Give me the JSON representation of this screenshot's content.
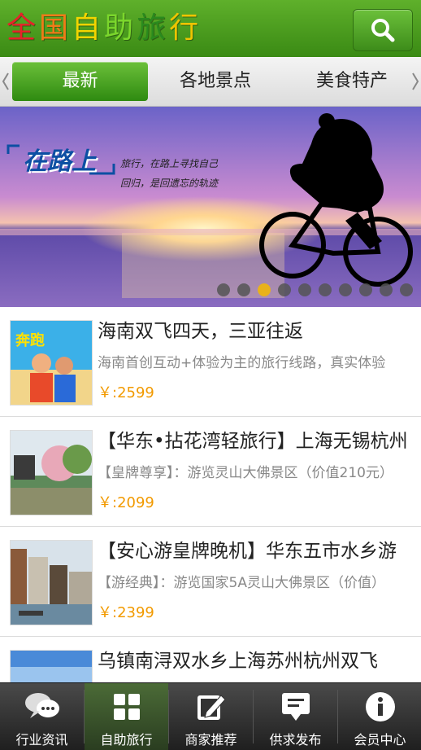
{
  "header": {
    "title_chars": [
      {
        "char": "全",
        "color": "#e8222a"
      },
      {
        "char": "国",
        "color": "#f07a18"
      },
      {
        "char": "自",
        "color": "#f2d400"
      },
      {
        "char": "助",
        "color": "#7bd62c"
      },
      {
        "char": "旅",
        "color": "#2a8a1e"
      },
      {
        "char": "行",
        "color": "#f0c400"
      }
    ],
    "search_icon": "search-icon"
  },
  "tabs": [
    {
      "label": "最新",
      "active": true
    },
    {
      "label": "各地景点",
      "active": false
    },
    {
      "label": "美食特产",
      "active": false
    }
  ],
  "banner": {
    "badge": "在路上",
    "line1": "旅行，在路上寻找自己",
    "line2": "回归，是回遗忘的轨迹",
    "dot_count": 10,
    "active_dot": 2,
    "colors": {
      "sky_top": "#6b63c8",
      "sky_mid": "#c98bd0",
      "sun": "#ffe6a0",
      "sea": "#5d4aa8"
    }
  },
  "list": [
    {
      "title": "海南双飞四天，三亚往返",
      "desc": "海南首创互动+体验为主的旅行线路，真实体验",
      "price": "￥:2599",
      "thumb": "beach-poster"
    },
    {
      "title": "【华东•拈花湾轻旅行】上海无锡杭州",
      "desc": "【皇牌尊享】：游览灵山大佛景区（价值210元）",
      "price": "￥:2099",
      "thumb": "garden-lake"
    },
    {
      "title": "【安心游皇牌晚机】华东五市水乡游",
      "desc": "【游经典】：游览国家5A灵山大佛景区（价值）",
      "price": "￥:2399",
      "thumb": "water-town"
    },
    {
      "title": "乌镇南浔双水乡上海苏州杭州双飞",
      "desc": "",
      "price": "",
      "thumb": "sky-lake"
    }
  ],
  "bottom_nav": [
    {
      "label": "行业资讯",
      "icon": "chat-bubbles-icon",
      "active": false
    },
    {
      "label": "自助旅行",
      "icon": "grid-icon",
      "active": true
    },
    {
      "label": "商家推荐",
      "icon": "edit-icon",
      "active": false
    },
    {
      "label": "供求发布",
      "icon": "publish-icon",
      "active": false
    },
    {
      "label": "会员中心",
      "icon": "info-icon",
      "active": false
    }
  ],
  "colors": {
    "accent_green": "#3a8a14",
    "price": "#f29a00"
  }
}
